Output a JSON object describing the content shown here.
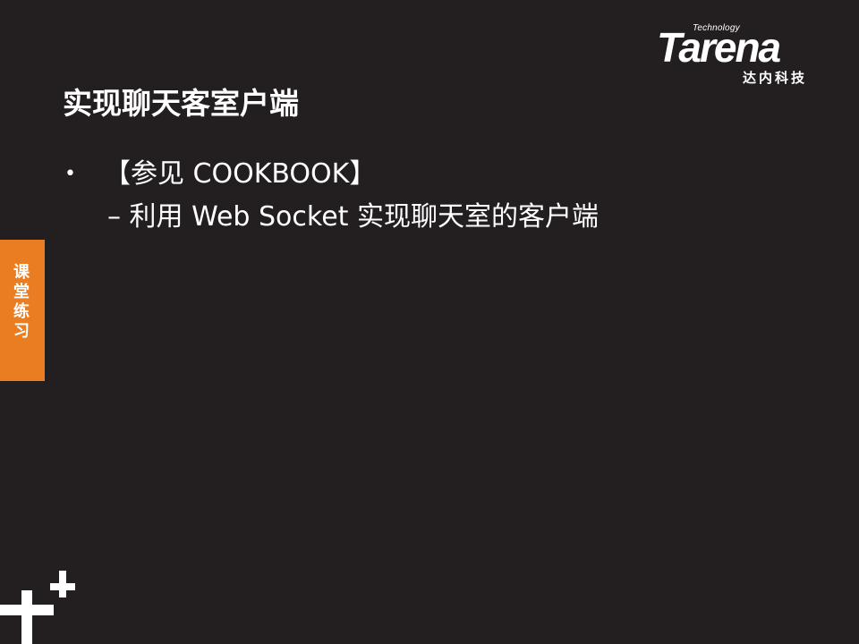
{
  "logo": {
    "technology": "Technology",
    "wordmark": "Tarena",
    "chinese": "达内科技"
  },
  "slide": {
    "title": "实现聊天客室户端",
    "bullet": "【参见 COOKBOOK】",
    "sub_item": "– 利用 Web Socket 实现聊天室的客户端"
  },
  "side_tab": {
    "label": "课堂练习",
    "color": "#ea7d21"
  },
  "colors": {
    "background": "#231f20",
    "text": "#ffffff"
  }
}
